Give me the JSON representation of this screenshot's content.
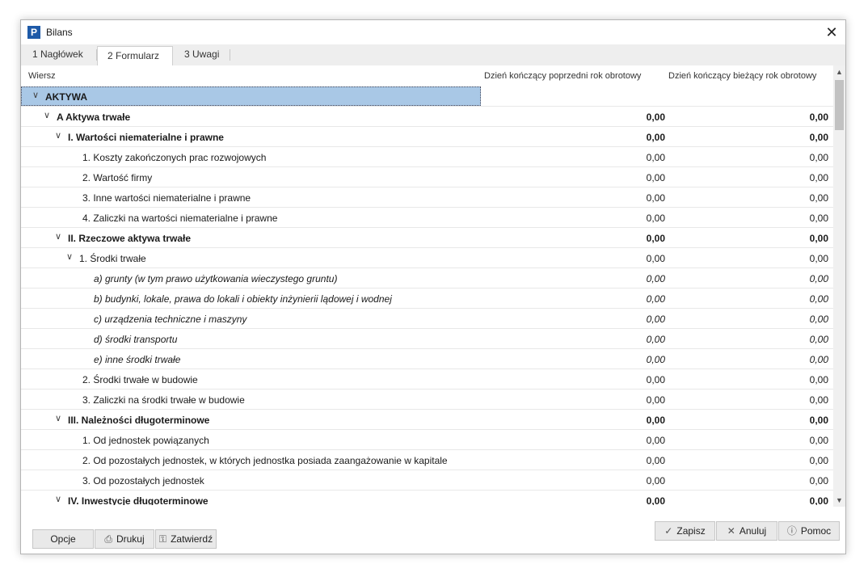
{
  "window": {
    "title": "Bilans",
    "icon_glyph": "P",
    "close_glyph": "✕"
  },
  "tabs": [
    {
      "label": "1 Nagłówek"
    },
    {
      "label": "2 Formularz"
    },
    {
      "label": "3 Uwagi"
    }
  ],
  "columns": {
    "row": "Wiersz",
    "prev": "Dzień kończący poprzedni rok obrotowy",
    "curr": "Dzień kończący bieżący rok obrotowy"
  },
  "rows": [
    {
      "name": "AKTYWA",
      "prev": "",
      "curr": "",
      "style": "header",
      "chevron": true
    },
    {
      "name": "A Aktywa trwałe",
      "prev": "0,00",
      "curr": "0,00",
      "style": "bold",
      "chevron": true
    },
    {
      "name": "I. Wartości niematerialne i prawne",
      "prev": "0,00",
      "curr": "0,00",
      "style": "bold",
      "chevron": true
    },
    {
      "name": "1. Koszty zakończonych prac rozwojowych",
      "prev": "0,00",
      "curr": "0,00",
      "style": "normal",
      "chevron": false
    },
    {
      "name": "2. Wartość firmy",
      "prev": "0,00",
      "curr": "0,00",
      "style": "normal",
      "chevron": false
    },
    {
      "name": "3. Inne wartości niematerialne i prawne",
      "prev": "0,00",
      "curr": "0,00",
      "style": "normal",
      "chevron": false
    },
    {
      "name": "4. Zaliczki na wartości niematerialne i prawne",
      "prev": "0,00",
      "curr": "0,00",
      "style": "normal",
      "chevron": false
    },
    {
      "name": "II. Rzeczowe aktywa trwałe",
      "prev": "0,00",
      "curr": "0,00",
      "style": "bold",
      "chevron": true
    },
    {
      "name": "1. Środki trwałe",
      "prev": "0,00",
      "curr": "0,00",
      "style": "normal",
      "chevron": true
    },
    {
      "name": "a) grunty (w tym prawo użytkowania wieczystego gruntu)",
      "prev": "0,00",
      "curr": "0,00",
      "style": "italic",
      "chevron": false
    },
    {
      "name": "b) budynki, lokale, prawa do lokali i obiekty inżynierii lądowej i wodnej",
      "prev": "0,00",
      "curr": "0,00",
      "style": "italic",
      "chevron": false
    },
    {
      "name": "c) urządzenia techniczne i maszyny",
      "prev": "0,00",
      "curr": "0,00",
      "style": "italic",
      "chevron": false
    },
    {
      "name": "d) środki transportu",
      "prev": "0,00",
      "curr": "0,00",
      "style": "italic",
      "chevron": false
    },
    {
      "name": "e) inne środki trwałe",
      "prev": "0,00",
      "curr": "0,00",
      "style": "italic",
      "chevron": false
    },
    {
      "name": "2. Środki trwałe w budowie",
      "prev": "0,00",
      "curr": "0,00",
      "style": "normal",
      "chevron": false
    },
    {
      "name": "3. Zaliczki na środki trwałe w budowie",
      "prev": "0,00",
      "curr": "0,00",
      "style": "normal",
      "chevron": false
    },
    {
      "name": "III. Należności długoterminowe",
      "prev": "0,00",
      "curr": "0,00",
      "style": "bold",
      "chevron": true
    },
    {
      "name": "1. Od jednostek powiązanych",
      "prev": "0,00",
      "curr": "0,00",
      "style": "normal",
      "chevron": false
    },
    {
      "name": "2. Od pozostałych jednostek, w których jednostka posiada zaangażowanie w kapitale",
      "prev": "0,00",
      "curr": "0,00",
      "style": "normal",
      "chevron": false
    },
    {
      "name": "3. Od pozostałych jednostek",
      "prev": "0,00",
      "curr": "0,00",
      "style": "normal",
      "chevron": false
    },
    {
      "name": "IV. Inwestycje długoterminowe",
      "prev": "0,00",
      "curr": "0,00",
      "style": "bold",
      "chevron": true
    }
  ],
  "footer": {
    "left": [
      {
        "label": "Opcje",
        "icon": ""
      },
      {
        "label": "Drukuj",
        "icon": "printer-icon"
      },
      {
        "label": "Zatwierdź",
        "icon": "lock-icon"
      }
    ],
    "right": [
      {
        "label": "Zapisz",
        "icon": "check-icon"
      },
      {
        "label": "Anuluj",
        "icon": "cross-icon"
      },
      {
        "label": "Pomoc",
        "icon": "help-icon"
      }
    ]
  },
  "colors": {
    "selection": "#a9c8e6",
    "tabstrip": "#eeeeee",
    "button": "#e9e9e9",
    "app_icon": "#1e5aa8"
  }
}
